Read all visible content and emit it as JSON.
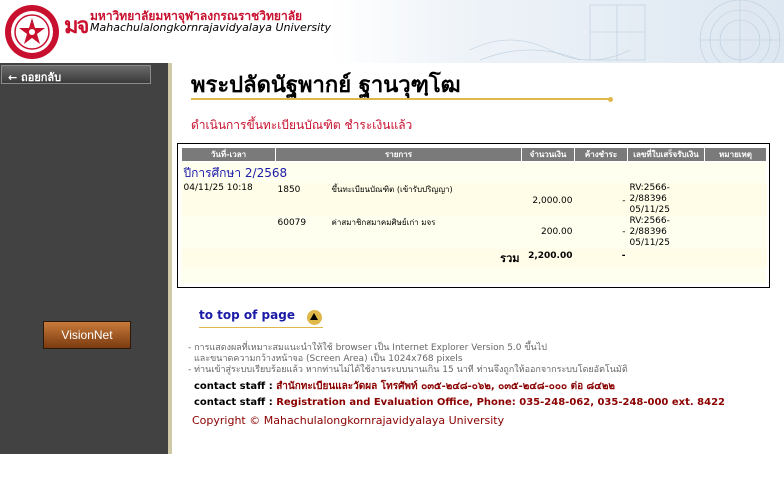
{
  "header": {
    "university_thai": "มหาวิทยาลัยมหาจุฬาลงกรณราชวิทยาลัย",
    "university_en": "Mahachulalongkornrajavidyalaya University",
    "mark": "มจ"
  },
  "sidebar": {
    "back_label": "← ถอยกลับ",
    "visionnet_label": "VisionNet"
  },
  "main": {
    "title": "พระปลัดนัฐพากย์ ฐานวุฑฺโฒ",
    "subtitle": "ดำเนินการขึ้นทะเบียนบัณฑิต ชำระเงินแล้ว"
  },
  "table": {
    "headers": [
      "วันที่-เวลา",
      "รายการ",
      "จำนวนเงิน",
      "ค้างชำระ",
      "เลขที่ใบเสร็จรับเงิน",
      "หมายเหตุ"
    ],
    "year_label": "ปีการศึกษา 2/2568",
    "rows": [
      {
        "datetime": "04/11/25 10:18",
        "code": "1850",
        "item": "ขึ้นทะเบียนบัณฑิต (เข้ารับปริญญา)",
        "amount": "2,000.00",
        "outstanding": "-",
        "receipt": [
          "RV:2566-",
          "2/88396",
          "05/11/25"
        ],
        "note": ""
      },
      {
        "datetime": "",
        "code": "60079",
        "item": "ค่าสมาชิกสมาคมศิษย์เก่า มจร",
        "amount": "200.00",
        "outstanding": "-",
        "receipt": [
          "RV:2566-",
          "2/88396",
          "05/11/25"
        ],
        "note": ""
      }
    ],
    "total_label": "รวม",
    "total_amount": "2,200.00",
    "total_outstanding": "-"
  },
  "footer": {
    "to_top": "to top of page",
    "note1": "- การแสดงผลที่เหมาะสมแนะนำให้ใช้ browser เป็น Internet Explorer Version 5.0 ขึ้นไป",
    "note2": "และขนาดความกว้างหน้าจอ (Screen Area) เป็น 1024x768 pixels",
    "note3": "- ท่านเข้าสู่ระบบเรียบร้อยแล้ว หากท่านไม่ได้ใช้งานระบบนานเกิน 15 นาที ท่านจึงถูกให้ออกจากระบบโดยอัตโนมัติ",
    "staff_label": "contact staff :",
    "staff_thai": "สำนักทะเบียนและวัดผล โทรศัพท์ ๐๓๕-๒๔๘-๐๖๒, ๐๓๕-๒๔๘-๐๐๐ ต่อ ๘๔๒๒",
    "staff_en": "Registration and Evaluation Office, Phone: 035-248-062, 035-248-000 ext. 8422",
    "copyright": "Copyright © Mahachulalongkornrajavidyalaya University"
  },
  "colors": {
    "accent_red": "#c8102e",
    "gold": "#e0b84a",
    "sidebar_bg": "#424242",
    "link_blue": "#1a1aa8"
  }
}
